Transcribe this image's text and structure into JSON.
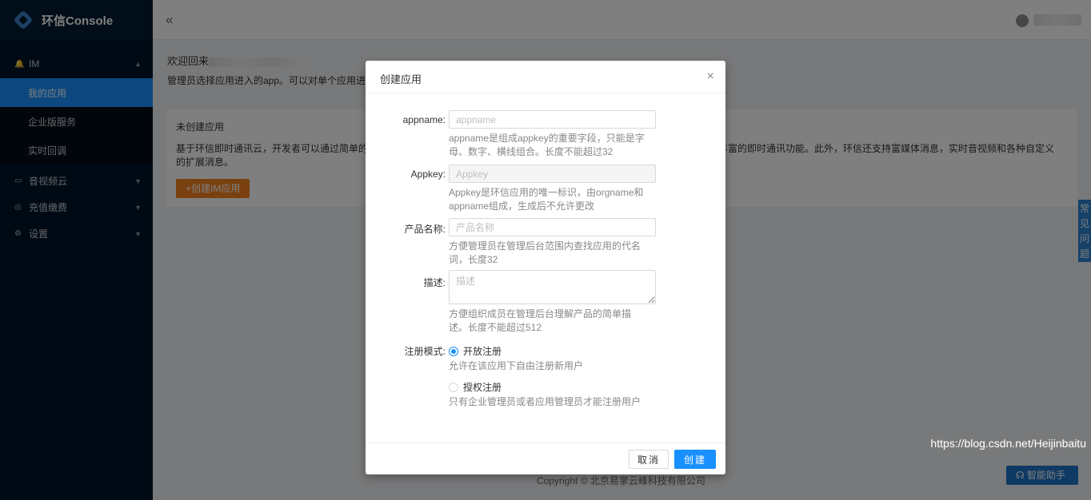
{
  "brand": {
    "title": "环信Console"
  },
  "sidebar": {
    "groups": [
      {
        "label": "IM",
        "icon": "bell-icon",
        "arrow": "▲"
      },
      {
        "label": "音视频云",
        "icon": "video-icon",
        "arrow": "▼"
      },
      {
        "label": "充值缴费",
        "icon": "coin-icon",
        "arrow": "▼"
      },
      {
        "label": "设置",
        "icon": "gear-icon",
        "arrow": "▼"
      }
    ],
    "im_items": [
      {
        "label": "我的应用",
        "active": true
      },
      {
        "label": "企业版服务"
      },
      {
        "label": "实时回调"
      }
    ]
  },
  "topbar": {
    "collapse": "«"
  },
  "main": {
    "welcome": "欢迎回来",
    "welcome_sub": "管理员选择应用进入的app。可以对单个应用进",
    "card_title": "未创建应用",
    "card_desc_left": "基于环信即时通讯云，开发者可以通过简单的",
    "card_desc_right": "丰富的即时通讯功能。此外，环信还支持富媒体消息，实时音视频和各种自定义",
    "card_desc_line2": "的扩展消息。",
    "create_button": "+创建IM应用",
    "copyright": "Copyright © 北京易掌云峰科技有限公司",
    "watermark": "https://blog.csdn.net/Heijinbaitu",
    "faq_tab": "常见问题",
    "assistant": "智能助手"
  },
  "modal": {
    "title": "创建应用",
    "close": "×",
    "appname_label": "appname:",
    "appname_placeholder": "appname",
    "appname_help": "appname是组成appkey的重要字段，只能是字母、数字、横线组合。长度不能超过32",
    "appkey_label": "Appkey:",
    "appkey_placeholder": "Appkey",
    "appkey_help": "Appkey是环信应用的唯一标识，由orgname和appname组成，生成后不允许更改",
    "product_label": "产品名称:",
    "product_placeholder": "产品名称",
    "product_help": "方便管理员在管理后台范围内查找应用的代名词，长度32",
    "desc_label": "描述:",
    "desc_placeholder": "描述",
    "desc_help": "方便组织成员在管理后台理解产品的简单描述。长度不能超过512",
    "reg_label": "注册模式:",
    "reg_open": "开放注册",
    "reg_open_help": "允许在该应用下自由注册新用户",
    "reg_auth": "授权注册",
    "reg_auth_help": "只有企业管理员或者应用管理员才能注册用户",
    "cancel": "取消",
    "create": "创建"
  }
}
